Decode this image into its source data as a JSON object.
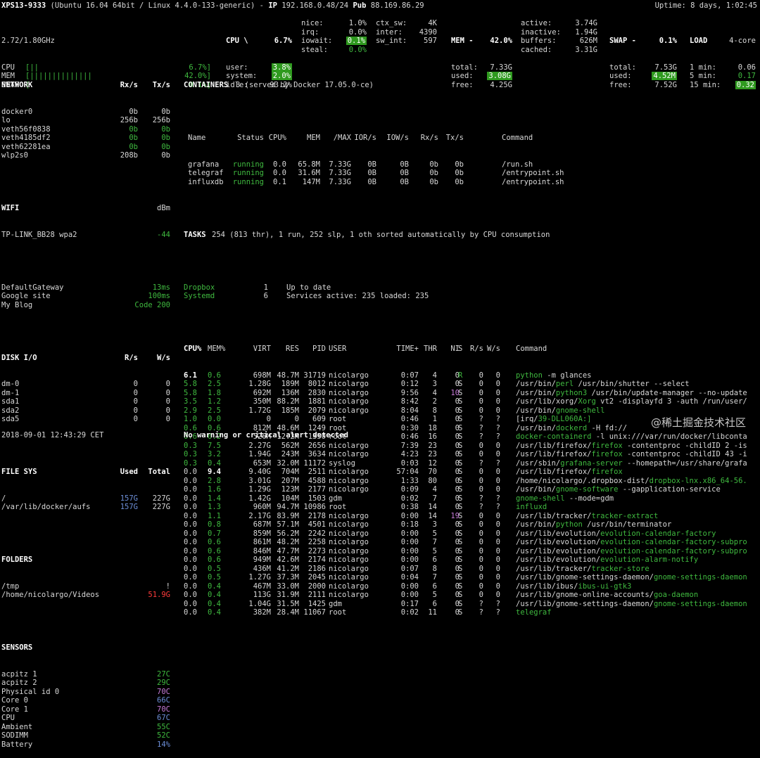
{
  "header": {
    "hostname": "XPS13-9333",
    "os": "(Ubuntu 16.04 64bit / Linux 4.4.0-133-generic)",
    "ip_label": "IP",
    "ip": "192.168.0.48/24",
    "pub_label": "Pub",
    "pub": "88.169.86.29",
    "uptime": "Uptime: 8 days, 1:02:45"
  },
  "quicklook": {
    "cpu_info": "2.72/1.80GHz",
    "rows": [
      {
        "label": "CPU",
        "bar": "[||",
        "value": "6.7%]"
      },
      {
        "label": "MEM",
        "bar": "[||||||||||||||",
        "value": "42.0%]"
      },
      {
        "label": "SWAP",
        "bar": "[",
        "value": "0.1%]"
      }
    ]
  },
  "cpu": {
    "title": "CPU \\",
    "total": "6.7%",
    "col1": [
      [
        "user:",
        "3.8%"
      ],
      [
        "system:",
        "2.0%"
      ],
      [
        "idle:",
        "93.2%"
      ]
    ],
    "col2": [
      [
        "nice:",
        "1.0%"
      ],
      [
        "irq:",
        "0.0%"
      ],
      [
        "iowait:",
        "0.1%"
      ],
      [
        "steal:",
        "0.0%"
      ]
    ],
    "col3": [
      [
        "ctx_sw:",
        "4K"
      ],
      [
        "inter:",
        "4390"
      ],
      [
        "sw_int:",
        "597"
      ]
    ]
  },
  "mem": {
    "title": "MEM -",
    "total_pct": "42.0%",
    "col1": [
      [
        "total:",
        "7.33G"
      ],
      [
        "used:",
        "3.08G"
      ],
      [
        "free:",
        "4.25G"
      ]
    ],
    "col2": [
      [
        "active:",
        "3.74G"
      ],
      [
        "inactive:",
        "1.94G"
      ],
      [
        "buffers:",
        "626M"
      ],
      [
        "cached:",
        "3.31G"
      ]
    ]
  },
  "swap": {
    "title": "SWAP -",
    "pct": "0.1%",
    "rows": [
      [
        "total:",
        "7.53G"
      ],
      [
        "used:",
        "4.52M"
      ],
      [
        "free:",
        "7.52G"
      ]
    ]
  },
  "load": {
    "title": "LOAD",
    "cores": "4-core",
    "rows": [
      [
        "1 min:",
        "0.06"
      ],
      [
        "5 min:",
        "0.17"
      ],
      [
        "15 min:",
        "0.32"
      ]
    ]
  },
  "network": {
    "title": "NETWORK",
    "rx": "Rx/s",
    "tx": "Tx/s",
    "rows": [
      [
        "docker0",
        "0b",
        "0b"
      ],
      [
        "lo",
        "256b",
        "256b"
      ],
      [
        "veth56f0838",
        "0b",
        "0b"
      ],
      [
        "veth4185df2",
        "0b",
        "0b"
      ],
      [
        "veth62281ea",
        "0b",
        "0b"
      ],
      [
        "wlp2s0",
        "208b",
        "0b"
      ]
    ]
  },
  "wifi": {
    "title": "WIFI",
    "unit": "dBm",
    "rows": [
      [
        "TP-LINK_BB28 wpa2",
        "-44"
      ]
    ]
  },
  "ports": [
    [
      "DefaultGateway",
      "13ms"
    ],
    [
      "Google site",
      "100ms"
    ],
    [
      "My Blog",
      "Code 200"
    ]
  ],
  "diskio": {
    "title": "DISK I/O",
    "r": "R/s",
    "w": "W/s",
    "rows": [
      [
        "dm-0",
        "0",
        "0"
      ],
      [
        "dm-1",
        "0",
        "0"
      ],
      [
        "sda1",
        "0",
        "0"
      ],
      [
        "sda2",
        "0",
        "0"
      ],
      [
        "sda5",
        "0",
        "0"
      ]
    ]
  },
  "fs": {
    "title": "FILE SYS",
    "used": "Used",
    "total": "Total",
    "rows": [
      [
        "/",
        "157G",
        "227G"
      ],
      [
        "/var/lib/docker/aufs",
        "157G",
        "227G"
      ]
    ]
  },
  "folders": {
    "title": "FOLDERS",
    "rows": [
      [
        "/tmp",
        "!"
      ],
      [
        "/home/nicolargo/Videos",
        "51.9G"
      ]
    ]
  },
  "sensors": {
    "title": "SENSORS",
    "rows": [
      [
        "acpitz 1",
        "27C"
      ],
      [
        "acpitz 2",
        "29C"
      ],
      [
        "Physical id 0",
        "70C"
      ],
      [
        "Core 0",
        "66C"
      ],
      [
        "Core 1",
        "70C"
      ],
      [
        "CPU",
        "67C"
      ],
      [
        "Ambient",
        "55C"
      ],
      [
        "SODIMM",
        "52C"
      ],
      [
        "Battery",
        "14%"
      ]
    ]
  },
  "containers": {
    "title": "CONTAINERS",
    "summary": "3 (served by Docker 17.05.0-ce)",
    "headers": [
      "Name",
      "Status",
      "CPU%",
      "MEM",
      "/MAX",
      "IOR/s",
      "IOW/s",
      "Rx/s",
      "Tx/s",
      "Command"
    ],
    "rows": [
      [
        "grafana",
        "running",
        "0.0",
        "65.8M",
        "7.33G",
        "0B",
        "0B",
        "0b",
        "0b",
        "/run.sh"
      ],
      [
        "telegraf",
        "running",
        "0.0",
        "31.6M",
        "7.33G",
        "0B",
        "0B",
        "0b",
        "0b",
        "/entrypoint.sh"
      ],
      [
        "influxdb",
        "running",
        "0.1",
        "147M",
        "7.33G",
        "0B",
        "0B",
        "0b",
        "0b",
        "/entrypoint.sh"
      ]
    ]
  },
  "tasks": {
    "title": "TASKS",
    "summary": "254 (813 thr), 1 run, 252 slp, 1 oth sorted automatically by CPU consumption"
  },
  "amps": [
    [
      "Dropbox",
      "1",
      "Up to date"
    ],
    [
      "Systemd",
      "6",
      "Services active: 235 loaded: 235"
    ]
  ],
  "processes": {
    "headers": [
      "CPU%",
      "MEM%",
      "VIRT",
      "RES",
      "PID",
      "USER",
      "TIME+",
      "THR",
      "NI",
      "S",
      "R/s",
      "W/s",
      "Command"
    ],
    "rows": [
      [
        "6.1",
        "0.6",
        "698M",
        "48.7M",
        "31719",
        "nicolargo",
        "0:07",
        "4",
        "0",
        "R",
        "0",
        "0",
        "python -m glances"
      ],
      [
        "5.8",
        "2.5",
        "1.28G",
        "189M",
        "8012",
        "nicolargo",
        "0:12",
        "3",
        "0",
        "S",
        "0",
        "0",
        "/usr/bin/perl /usr/bin/shutter --select"
      ],
      [
        "5.8",
        "1.8",
        "692M",
        "136M",
        "2830",
        "nicolargo",
        "9:56",
        "4",
        "10",
        "S",
        "0",
        "0",
        "/usr/bin/python3 /usr/bin/update-manager --no-update"
      ],
      [
        "3.5",
        "1.2",
        "350M",
        "88.2M",
        "1881",
        "nicolargo",
        "8:42",
        "2",
        "0",
        "S",
        "0",
        "0",
        "/usr/lib/xorg/Xorg vt2 -displayfd 3 -auth /run/user/"
      ],
      [
        "2.9",
        "2.5",
        "1.72G",
        "185M",
        "2079",
        "nicolargo",
        "8:04",
        "8",
        "0",
        "S",
        "0",
        "0",
        "/usr/bin/gnome-shell"
      ],
      [
        "1.0",
        "0.0",
        "0",
        "0",
        "609",
        "root",
        "0:46",
        "1",
        "0",
        "S",
        "?",
        "?",
        "[irq/39-DLL060A:]"
      ],
      [
        "0.6",
        "0.6",
        "812M",
        "48.6M",
        "1249",
        "root",
        "0:30",
        "18",
        "0",
        "S",
        "?",
        "?",
        "/usr/bin/dockerd -H fd://"
      ],
      [
        "0.6",
        "0.2",
        "526M",
        "12.2M",
        "1350",
        "root",
        "0:46",
        "16",
        "0",
        "S",
        "?",
        "?",
        "docker-containerd -l unix:///var/run/docker/libconta"
      ],
      [
        "0.3",
        "7.5",
        "2.27G",
        "562M",
        "2656",
        "nicolargo",
        "7:39",
        "23",
        "0",
        "S",
        "0",
        "0",
        "/usr/lib/firefox/firefox -contentproc -childID 2 -is"
      ],
      [
        "0.3",
        "3.2",
        "1.94G",
        "243M",
        "3634",
        "nicolargo",
        "4:23",
        "23",
        "0",
        "S",
        "0",
        "0",
        "/usr/lib/firefox/firefox -contentproc -childID 43 -i"
      ],
      [
        "0.3",
        "0.4",
        "653M",
        "32.0M",
        "11172",
        "syslog",
        "0:03",
        "12",
        "0",
        "S",
        "?",
        "?",
        "/usr/sbin/grafana-server --homepath=/usr/share/grafa"
      ],
      [
        "0.0",
        "9.4",
        "9.40G",
        "704M",
        "2511",
        "nicolargo",
        "57:04",
        "70",
        "0",
        "S",
        "0",
        "0",
        "/usr/lib/firefox/firefox"
      ],
      [
        "0.0",
        "2.8",
        "3.01G",
        "207M",
        "4588",
        "nicolargo",
        "1:33",
        "80",
        "0",
        "S",
        "0",
        "0",
        "/home/nicolargo/.dropbox-dist/dropbox-lnx.x86_64-56."
      ],
      [
        "0.0",
        "1.6",
        "1.29G",
        "123M",
        "2177",
        "nicolargo",
        "0:09",
        "4",
        "0",
        "S",
        "0",
        "0",
        "/usr/bin/gnome-software --gapplication-service"
      ],
      [
        "0.0",
        "1.4",
        "1.42G",
        "104M",
        "1503",
        "gdm",
        "0:02",
        "7",
        "0",
        "S",
        "?",
        "?",
        "gnome-shell --mode=gdm"
      ],
      [
        "0.0",
        "1.3",
        "960M",
        "94.7M",
        "10986",
        "root",
        "0:38",
        "14",
        "0",
        "S",
        "?",
        "?",
        "influxd"
      ],
      [
        "0.0",
        "1.1",
        "2.17G",
        "83.9M",
        "2178",
        "nicolargo",
        "0:00",
        "14",
        "19",
        "S",
        "0",
        "0",
        "/usr/lib/tracker/tracker-extract"
      ],
      [
        "0.0",
        "0.8",
        "687M",
        "57.1M",
        "4501",
        "nicolargo",
        "0:18",
        "3",
        "0",
        "S",
        "0",
        "0",
        "/usr/bin/python /usr/bin/terminator"
      ],
      [
        "0.0",
        "0.7",
        "859M",
        "56.2M",
        "2242",
        "nicolargo",
        "0:00",
        "5",
        "0",
        "S",
        "0",
        "0",
        "/usr/lib/evolution/evolution-calendar-factory"
      ],
      [
        "0.0",
        "0.6",
        "861M",
        "48.2M",
        "2258",
        "nicolargo",
        "0:00",
        "7",
        "0",
        "S",
        "0",
        "0",
        "/usr/lib/evolution/evolution-calendar-factory-subpro"
      ],
      [
        "0.0",
        "0.6",
        "846M",
        "47.7M",
        "2273",
        "nicolargo",
        "0:00",
        "5",
        "0",
        "S",
        "0",
        "0",
        "/usr/lib/evolution/evolution-calendar-factory-subpro"
      ],
      [
        "0.0",
        "0.6",
        "949M",
        "42.6M",
        "2174",
        "nicolargo",
        "0:00",
        "6",
        "0",
        "S",
        "0",
        "0",
        "/usr/lib/evolution/evolution-alarm-notify"
      ],
      [
        "0.0",
        "0.5",
        "436M",
        "41.2M",
        "2186",
        "nicolargo",
        "0:07",
        "8",
        "0",
        "S",
        "0",
        "0",
        "/usr/lib/tracker/tracker-store"
      ],
      [
        "0.0",
        "0.5",
        "1.27G",
        "37.3M",
        "2045",
        "nicolargo",
        "0:04",
        "7",
        "0",
        "S",
        "0",
        "0",
        "/usr/lib/gnome-settings-daemon/gnome-settings-daemon"
      ],
      [
        "0.0",
        "0.4",
        "467M",
        "33.0M",
        "2000",
        "nicolargo",
        "0:00",
        "6",
        "0",
        "S",
        "0",
        "0",
        "/usr/lib/ibus/ibus-ui-gtk3"
      ],
      [
        "0.0",
        "0.4",
        "113G",
        "31.9M",
        "2111",
        "nicolargo",
        "0:00",
        "5",
        "0",
        "S",
        "0",
        "0",
        "/usr/lib/gnome-online-accounts/goa-daemon"
      ],
      [
        "0.0",
        "0.4",
        "1.04G",
        "31.5M",
        "1425",
        "gdm",
        "0:17",
        "6",
        "0",
        "S",
        "?",
        "?",
        "/usr/lib/gnome-settings-daemon/gnome-settings-daemon"
      ],
      [
        "0.0",
        "0.4",
        "382M",
        "28.4M",
        "11067",
        "root",
        "0:02",
        "11",
        "0",
        "S",
        "?",
        "?",
        "telegraf"
      ]
    ]
  },
  "footer": {
    "datetime": "2018-09-01 12:43:29 CET",
    "alert": "No warning or critical alert detected",
    "watermark": "@稀土掘金技术社区"
  },
  "colors": {
    "background": "#000000",
    "ok": "#3fb93f",
    "careful": "#6d8fd8",
    "warning": "#c67bd8",
    "critical": "#ff3b3b",
    "highlight_bg": "#2f9a1f"
  }
}
